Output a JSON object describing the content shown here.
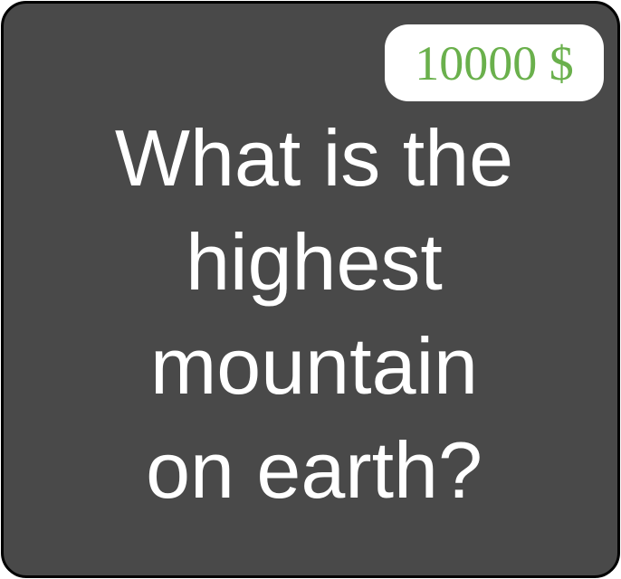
{
  "card": {
    "prize": "10000 $",
    "question": "What is the\nhighest\nmountain\non earth?"
  },
  "colors": {
    "card_background": "#494949",
    "card_border": "#000000",
    "prize_background": "#ffffff",
    "prize_text": "#6ab04c",
    "question_text": "#ffffff"
  }
}
